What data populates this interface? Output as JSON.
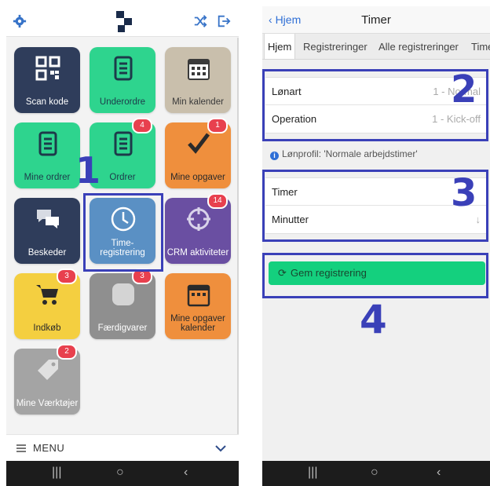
{
  "left": {
    "tiles": [
      {
        "label": "Scan kode",
        "badge": ""
      },
      {
        "label": "Underordre",
        "badge": ""
      },
      {
        "label": "Min kalender",
        "badge": ""
      },
      {
        "label": "Mine ordrer",
        "badge": ""
      },
      {
        "label": "Ordrer",
        "badge": "4"
      },
      {
        "label": "Mine opgaver",
        "badge": "1"
      },
      {
        "label": "Beskeder",
        "badge": ""
      },
      {
        "label": "Time-registrering",
        "badge": ""
      },
      {
        "label": "CRM aktiviteter",
        "badge": "14"
      },
      {
        "label": "Indkøb",
        "badge": "3"
      },
      {
        "label": "Færdigvarer",
        "badge": "3"
      },
      {
        "label": "Mine opgaver kalender",
        "badge": ""
      },
      {
        "label": "Mine Værktøjer",
        "badge": "2"
      }
    ],
    "menu_label": "MENU",
    "annotation": "1"
  },
  "right": {
    "back_label": "Hjem",
    "title": "Timer",
    "tabs": [
      "Hjem",
      "Registreringer",
      "Alle registreringer",
      "Time"
    ],
    "section1": {
      "rows": [
        {
          "label": "Lønart",
          "value": "1 - Normal"
        },
        {
          "label": "Operation",
          "value": "1 - Kick-off"
        }
      ]
    },
    "info_text": "Lønprofil: 'Normale arbejdstimer'",
    "section2": {
      "rows": [
        {
          "label": "Timer",
          "value": ""
        },
        {
          "label": "Minutter",
          "value": "↓"
        }
      ]
    },
    "save_label": "Gem registrering",
    "annotations": [
      "2",
      "3",
      "4"
    ]
  },
  "colors": {
    "highlight": "#3a40b8",
    "save_green": "#14d07e",
    "link_blue": "#2f6fd6"
  }
}
